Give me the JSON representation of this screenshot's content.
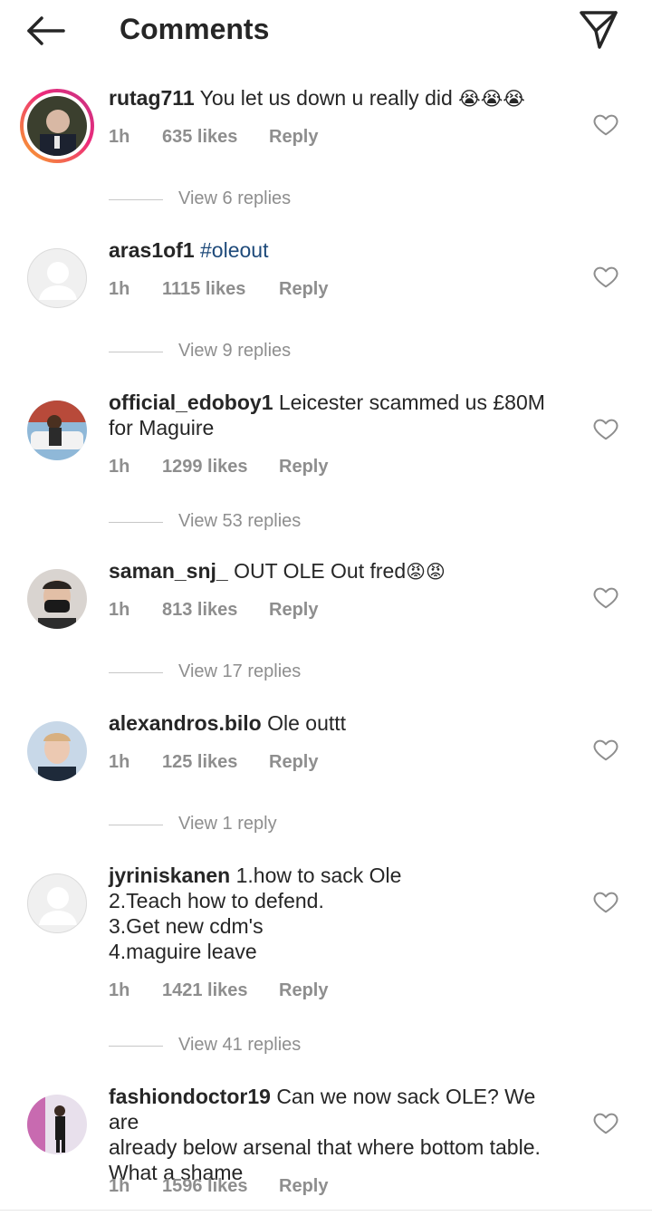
{
  "header": {
    "title": "Comments",
    "back_icon": "arrow-left-icon",
    "share_icon": "paper-plane-icon"
  },
  "comments": [
    {
      "username": "rutag711",
      "text": "You let us down u really did",
      "emoji": "😭😭😭",
      "time": "1h",
      "likes": "635 likes",
      "reply": "Reply",
      "view_replies": "View 6 replies"
    },
    {
      "username": "aras1of1",
      "text": "",
      "hashtag": "#oleout",
      "time": "1h",
      "likes": "1115 likes",
      "reply": "Reply",
      "view_replies": "View 9 replies"
    },
    {
      "username": "official_edoboy1",
      "text": "Leicester scammed us £80M",
      "text2": "for Maguire",
      "time": "1h",
      "likes": "1299 likes",
      "reply": "Reply",
      "view_replies": "View 53 replies"
    },
    {
      "username": "saman_snj_",
      "text": "OUT OLE Out fred",
      "emoji": "😡😡",
      "time": "1h",
      "likes": "813 likes",
      "reply": "Reply",
      "view_replies": "View 17 replies"
    },
    {
      "username": "alexandros.bilo",
      "text": "Ole outtt",
      "time": "1h",
      "likes": "125 likes",
      "reply": "Reply",
      "view_replies": "View 1 reply"
    },
    {
      "username": "jyriniskanen",
      "text": "1.how to sack Ole",
      "line2": "2.Teach how to defend.",
      "line3": "3.Get new cdm's",
      "line4": "4.maguire leave",
      "time": "1h",
      "likes": "1421 likes",
      "reply": "Reply",
      "view_replies": "View 41 replies"
    },
    {
      "username": "fashiondoctor19",
      "text": "Can we now sack OLE? We are",
      "line2": "already below arsenal that where bottom table.",
      "line3": "What a shame",
      "time": "1h",
      "likes": "1596 likes",
      "reply": "Reply"
    }
  ],
  "icons": {
    "like": "heart-outline-icon"
  }
}
